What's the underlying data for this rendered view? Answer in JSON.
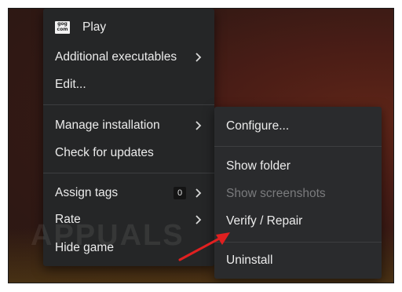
{
  "menu": {
    "items": [
      {
        "label": "Play"
      },
      {
        "label": "Additional executables"
      },
      {
        "label": "Edit..."
      },
      {
        "label": "Manage installation"
      },
      {
        "label": "Check for updates"
      },
      {
        "label": "Assign tags",
        "badge": "0"
      },
      {
        "label": "Rate"
      },
      {
        "label": "Hide game"
      }
    ]
  },
  "submenu": {
    "items": [
      {
        "label": "Configure..."
      },
      {
        "label": "Show folder"
      },
      {
        "label": "Show screenshots",
        "disabled": true
      },
      {
        "label": "Verify / Repair"
      },
      {
        "label": "Uninstall"
      }
    ]
  },
  "icons": {
    "gog_icon_text": "gog com"
  },
  "colors": {
    "menu_bg": "#252627",
    "arrow": "#e02020"
  },
  "watermark": "APPUALS"
}
